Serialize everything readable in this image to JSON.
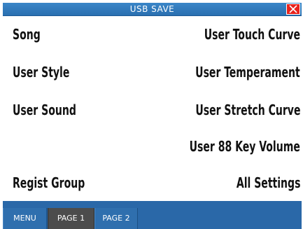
{
  "titlebar": {
    "title": "USB SAVE",
    "close_icon": "close-icon"
  },
  "items": {
    "song": "Song",
    "user_style": "User Style",
    "user_sound": "User Sound",
    "regist_group": "Regist Group",
    "user_touch_curve": "User Touch Curve",
    "user_temperament": "User Temperament",
    "user_stretch_curve": "User Stretch Curve",
    "user_88_key_volume": "User 88 Key Volume",
    "all_settings": "All Settings"
  },
  "tabs": {
    "menu": "MENU",
    "page1": "PAGE 1",
    "page2": "PAGE 2"
  },
  "colors": {
    "accent": "#2a6fb0",
    "close": "#e8231d",
    "active_tab": "#4c4c4c"
  }
}
